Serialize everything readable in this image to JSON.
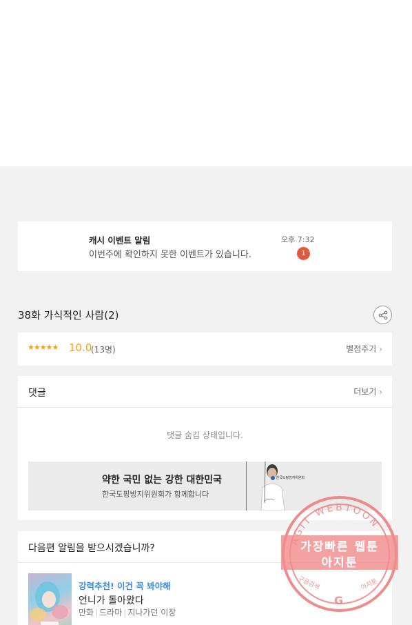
{
  "notification": {
    "title": "캐시 이벤트 알림",
    "message": "이번주에 확인하지 못한 이벤트가 있습니다.",
    "time": "오후 7:32",
    "badge": "1"
  },
  "episode": {
    "title": "38화 가식적인 사람(2)",
    "share_icon": "share-icon"
  },
  "rating": {
    "stars": "★★★★★",
    "score": "10.0",
    "votes": "(13명)",
    "rate_label": "별점주기",
    "star_color": "#f5a30a"
  },
  "comments": {
    "title": "댓글",
    "more_label": "더보기",
    "hidden_message": "댓글 숨김 상태입니다."
  },
  "ad": {
    "headline": "약한 국민 없는 강한 대한민국",
    "subline": "한국도핑방지위원회가 함께합니다",
    "logo_text": "한국도핑방지위원회"
  },
  "next_episode": {
    "question": "다음편 알림을 받으시겠습니까?",
    "recommend_tag": "강력추천! 이건 꼭 봐야해",
    "recommend_title": "언니가 돌아왔다",
    "genre1": "만화",
    "genre2": "드라마",
    "author": "지나가던 이장",
    "tag_color": "#3a8ee0"
  },
  "watermark": {
    "ring_text": "AGIT WEBTOON",
    "line1": "가장빠른 웹툰",
    "line2": "아지툰",
    "bottom_left": "구글검색",
    "bottom_right": "아지툰"
  }
}
